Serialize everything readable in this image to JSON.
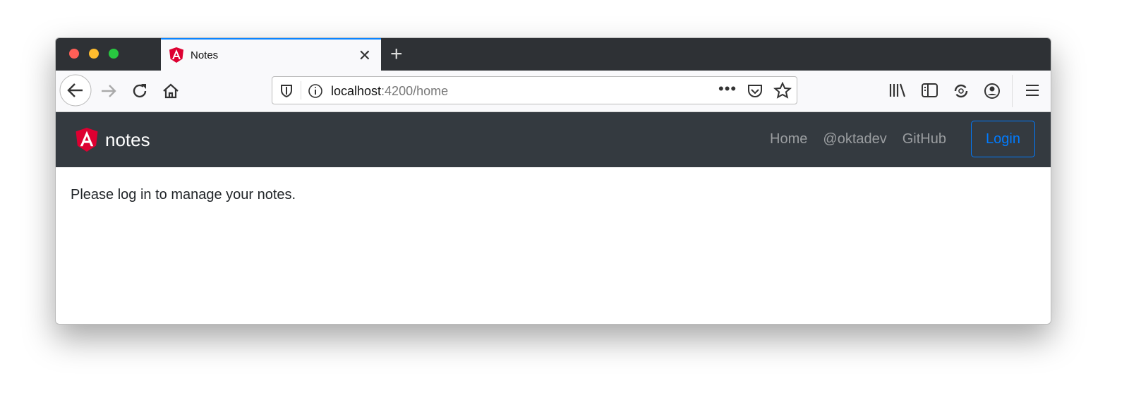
{
  "browser": {
    "tab_title": "Notes",
    "url_host": "localhost",
    "url_rest": ":4200/home"
  },
  "app": {
    "brand": "notes",
    "nav_links": [
      "Home",
      "@oktadev",
      "GitHub"
    ],
    "login_label": "Login",
    "message": "Please log in to manage your notes."
  },
  "colors": {
    "accent": "#007bff",
    "navbar": "#343a40",
    "angular_red": "#dd0031"
  }
}
